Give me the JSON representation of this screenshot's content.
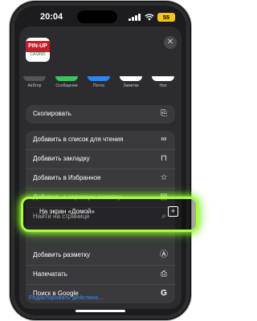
{
  "status": {
    "time": "20:04",
    "battery": "55"
  },
  "app": {
    "name": "PIN-UP",
    "sub": "CASINO"
  },
  "share_targets": [
    {
      "label": "AirDrop",
      "color": "#555555"
    },
    {
      "label": "Сообщения",
      "color": "#34c759"
    },
    {
      "label": "Почта",
      "color": "#2b86f7"
    },
    {
      "label": "Заметки",
      "color": "#ffffff"
    },
    {
      "label": "Нап",
      "color": "#ffffff"
    }
  ],
  "actions_group1": [
    {
      "label": "Скопировать",
      "icon": "copy-icon"
    }
  ],
  "actions_group2": [
    {
      "label": "Добавить в список для чтения",
      "icon": "glasses-icon"
    },
    {
      "label": "Добавить закладку",
      "icon": "book-icon"
    },
    {
      "label": "Добавить в Избранное",
      "icon": "star-icon"
    },
    {
      "label": "Добавить в короткую заметку",
      "icon": "note-icon"
    },
    {
      "label": "Найти на странице",
      "icon": "find-icon"
    },
    {
      "label": "На экран «Домой»",
      "icon": "add-square-icon"
    },
    {
      "label": "Добавить разметку",
      "icon": "markup-icon"
    },
    {
      "label": "Напечатать",
      "icon": "printer-icon"
    },
    {
      "label": "Поиск в Google",
      "icon": "google-icon"
    }
  ],
  "edit_actions": "Редактировать действия...",
  "accent": "#a6ff3b"
}
